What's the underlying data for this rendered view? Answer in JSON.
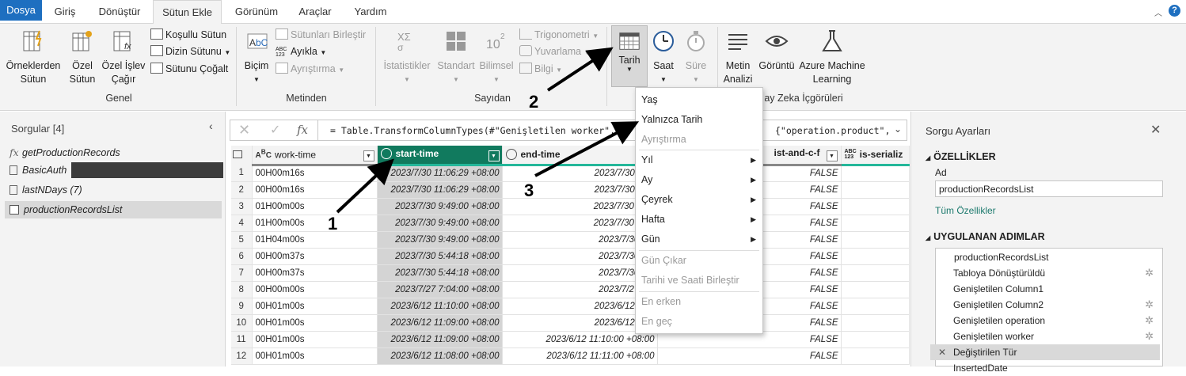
{
  "tabs": [
    "Dosya",
    "Giriş",
    "Dönüştür",
    "Sütun Ekle",
    "Görünüm",
    "Araçlar",
    "Yardım"
  ],
  "ribbon": {
    "col_from_examples": "Örneklerden Sütun",
    "custom_col": "Özel Sütun",
    "invoke_custom": "Özel İşlev Çağır",
    "conditional": "Koşullu Sütun",
    "index": "Dizin Sütunu",
    "duplicate": "Sütunu Çoğalt",
    "group_general": "Genel",
    "format": "Biçim",
    "merge": "Sütunları Birleştir",
    "extract": "Ayıkla",
    "parse": "Ayrıştırma",
    "group_text": "Metinden",
    "stats": "İstatistikler",
    "standard": "Standart",
    "scientific": "Bilimsel",
    "trig": "Trigonometri",
    "rounding": "Yuvarlama",
    "info": "Bilgi",
    "group_number": "Sayıdan",
    "date": "Tarih",
    "time": "Saat",
    "duration": "Süre",
    "text_analytics": "Metin Analizi",
    "vision": "Görüntü",
    "azure_ml": "Azure Machine Learning",
    "group_ai": "ay Zeka İçgörüleri"
  },
  "queries": {
    "header": "Sorgular [4]",
    "items": [
      "getProductionRecords",
      "BasicAuth",
      "lastNDays (7)",
      "productionRecordsList"
    ]
  },
  "formula": "= Table.TransformColumnTypes(#\"Genişletilen worker\",{{",
  "formula_tail": "{\"operation.product\",",
  "columns": [
    "work-time",
    "start-time",
    "end-time",
    "ist-and-c-f",
    "is-serializ"
  ],
  "rows": [
    [
      "1",
      "00H00m16s",
      "2023/7/30 11:06:29 +08:00",
      "2023/7/30 11:0",
      "FALSE"
    ],
    [
      "2",
      "00H00m16s",
      "2023/7/30 11:06:29 +08:00",
      "2023/7/30 11:0",
      "FALSE"
    ],
    [
      "3",
      "01H00m00s",
      "2023/7/30 9:49:00 +08:00",
      "2023/7/30 10:4",
      "FALSE"
    ],
    [
      "4",
      "01H00m00s",
      "2023/7/30 9:49:00 +08:00",
      "2023/7/30 10:4",
      "FALSE"
    ],
    [
      "5",
      "01H04m00s",
      "2023/7/30 9:49:00 +08:00",
      "2023/7/30 9:4",
      "FALSE"
    ],
    [
      "6",
      "00H00m37s",
      "2023/7/30 5:44:18 +08:00",
      "2023/7/30 5:4",
      "FALSE"
    ],
    [
      "7",
      "00H00m37s",
      "2023/7/30 5:44:18 +08:00",
      "2023/7/30 5:4",
      "FALSE"
    ],
    [
      "8",
      "00H00m00s",
      "2023/7/27 7:04:00 +08:00",
      "2023/7/27 7:0",
      "FALSE"
    ],
    [
      "9",
      "00H01m00s",
      "2023/6/12 11:10:00 +08:00",
      "2023/6/12 11:1",
      "FALSE"
    ],
    [
      "10",
      "00H01m00s",
      "2023/6/12 11:09:00 +08:00",
      "2023/6/12 11:1",
      "FALSE"
    ],
    [
      "11",
      "00H01m00s",
      "2023/6/12 11:09:00 +08:00",
      "2023/6/12 11:10:00 +08:00",
      "FALSE"
    ],
    [
      "12",
      "00H01m00s",
      "2023/6/12 11:08:00 +08:00",
      "2023/6/12 11:11:00 +08:00",
      "FALSE"
    ]
  ],
  "menu": [
    "Yaş",
    "Yalnızca Tarih",
    "Ayrıştırma",
    "Yıl",
    "Ay",
    "Çeyrek",
    "Hafta",
    "Gün",
    "Gün Çıkar",
    "Tarihi ve Saati Birleştir",
    "En erken",
    "En geç"
  ],
  "settings": {
    "title": "Sorgu Ayarları",
    "props": "ÖZELLİKLER",
    "name_label": "Ad",
    "name_value": "productionRecordsList",
    "all_props": "Tüm Özellikler",
    "applied": "UYGULANAN ADIMLAR",
    "steps": [
      "productionRecordsList",
      "Tabloya Dönüştürüldü",
      "Genişletilen Column1",
      "Genişletilen Column2",
      "Genişletilen operation",
      "Genişletilen worker",
      "Değiştirilen Tür",
      "InsertedDate"
    ]
  },
  "annotations": [
    "1",
    "2",
    "3"
  ]
}
